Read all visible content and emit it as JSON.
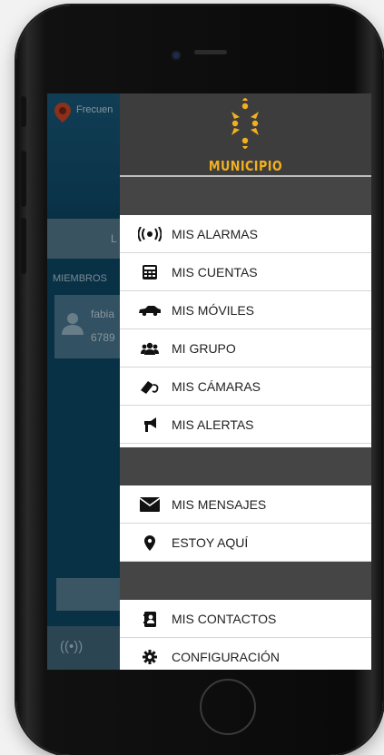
{
  "background_app": {
    "title": "Frecuen",
    "tab_label": "L",
    "section_label": "MIEMBROS",
    "member_name": "fabia",
    "member_number": "6789"
  },
  "drawer": {
    "brand": "MUNICIPIO",
    "groups": [
      {
        "items": [
          {
            "icon": "broadcast-icon",
            "label": "MIS ALARMAS"
          },
          {
            "icon": "calculator-icon",
            "label": "MIS CUENTAS"
          },
          {
            "icon": "car-icon",
            "label": "MIS MÓVILES"
          },
          {
            "icon": "group-icon",
            "label": "MI GRUPO"
          },
          {
            "icon": "camera-icon",
            "label": "MIS CÁMARAS"
          },
          {
            "icon": "megaphone-icon",
            "label": "MIS ALERTAS"
          }
        ]
      },
      {
        "items": [
          {
            "icon": "envelope-icon",
            "label": "MIS MENSAJES"
          },
          {
            "icon": "map-marker-icon",
            "label": "ESTOY AQUÍ"
          }
        ]
      },
      {
        "items": [
          {
            "icon": "contacts-icon",
            "label": "MIS CONTACTOS"
          },
          {
            "icon": "gear-icon",
            "label": "CONFIGURACIÓN"
          }
        ]
      }
    ]
  },
  "colors": {
    "brand_gold": "#f2b01e",
    "drawer_header": "#3d3d3d",
    "separator": "#454545"
  }
}
